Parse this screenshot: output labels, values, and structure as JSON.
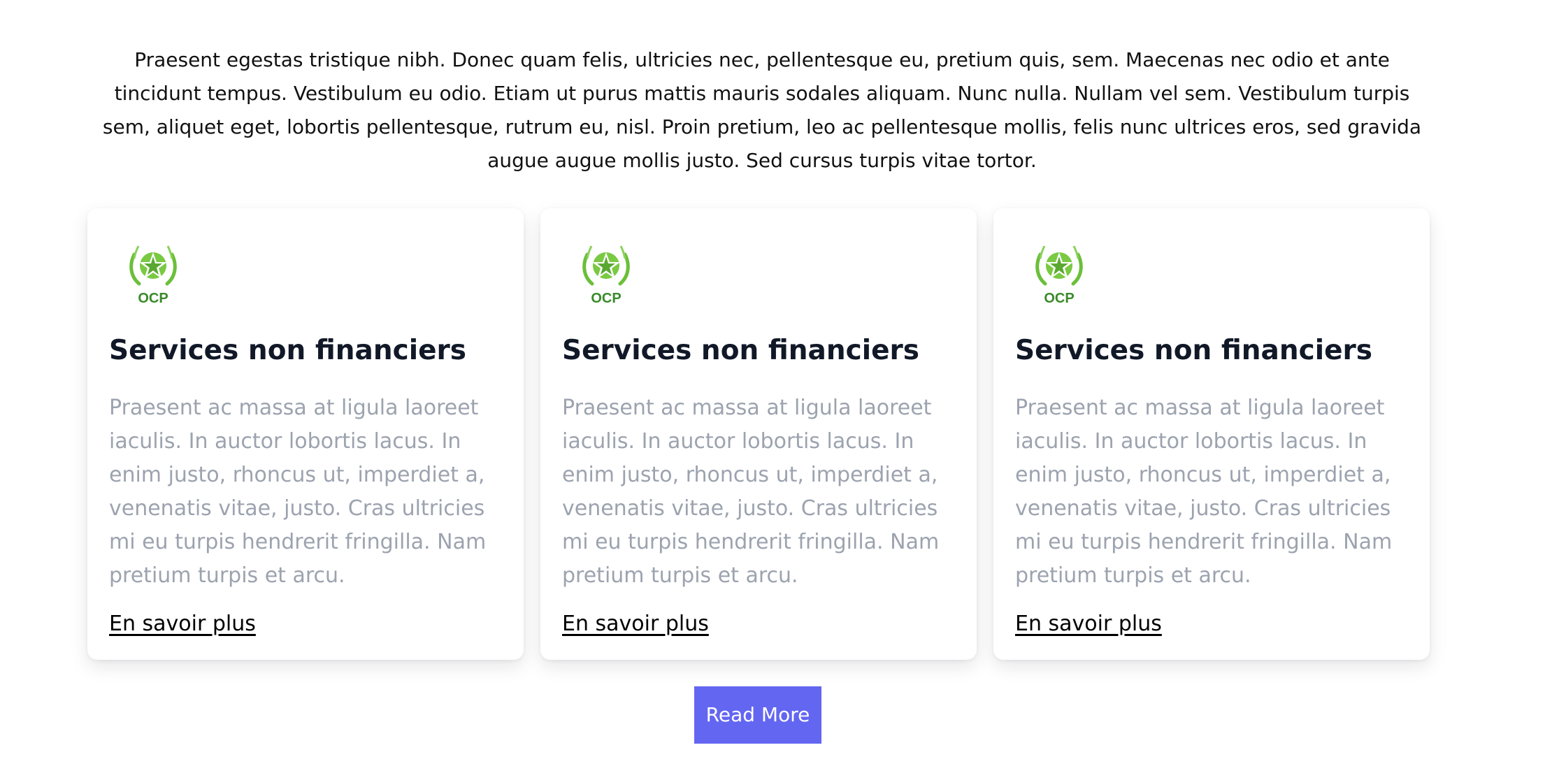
{
  "intro": {
    "text": "Praesent egestas tristique nibh. Donec quam felis, ultricies nec, pellentesque eu, pretium quis, sem. Maecenas nec odio et ante tincidunt tempus. Vestibulum eu odio. Etiam ut purus mattis mauris sodales aliquam. Nunc nulla. Nullam vel sem. Vestibulum turpis sem, aliquet eget, lobortis pellentesque, rutrum eu, nisl. Proin pretium, leo ac pellentesque mollis, felis nunc ultrices eros, sed gravida augue augue mollis justo. Sed cursus turpis vitae tortor."
  },
  "cards": [
    {
      "logo_text": "OCP",
      "title": "Services non financiers",
      "text": "Praesent ac massa at ligula laoreet iaculis. In auctor lobortis lacus. In enim justo, rhoncus ut, imperdiet a, venenatis vitae, justo. Cras ultricies mi eu turpis hendrerit fringilla. Nam pretium turpis et arcu.",
      "link": "En savoir plus"
    },
    {
      "logo_text": "OCP",
      "title": "Services non financiers",
      "text": "Praesent ac massa at ligula laoreet iaculis. In auctor lobortis lacus. In enim justo, rhoncus ut, imperdiet a, venenatis vitae, justo. Cras ultricies mi eu turpis hendrerit fringilla. Nam pretium turpis et arcu.",
      "link": "En savoir plus"
    },
    {
      "logo_text": "OCP",
      "title": "Services non financiers",
      "text": "Praesent ac massa at ligula laoreet iaculis. In auctor lobortis lacus. In enim justo, rhoncus ut, imperdiet a, venenatis vitae, justo. Cras ultricies mi eu turpis hendrerit fringilla. Nam pretium turpis et arcu.",
      "link": "En savoir plus"
    }
  ],
  "read_more": {
    "label": "Read More"
  },
  "colors": {
    "button": "#6366f1",
    "logo_green": "#6bbf3a",
    "logo_dark_green": "#3a8a2a",
    "title": "#111827",
    "muted_text": "#9ca3af"
  },
  "icons": {
    "logo": "ocp-logo-icon"
  }
}
